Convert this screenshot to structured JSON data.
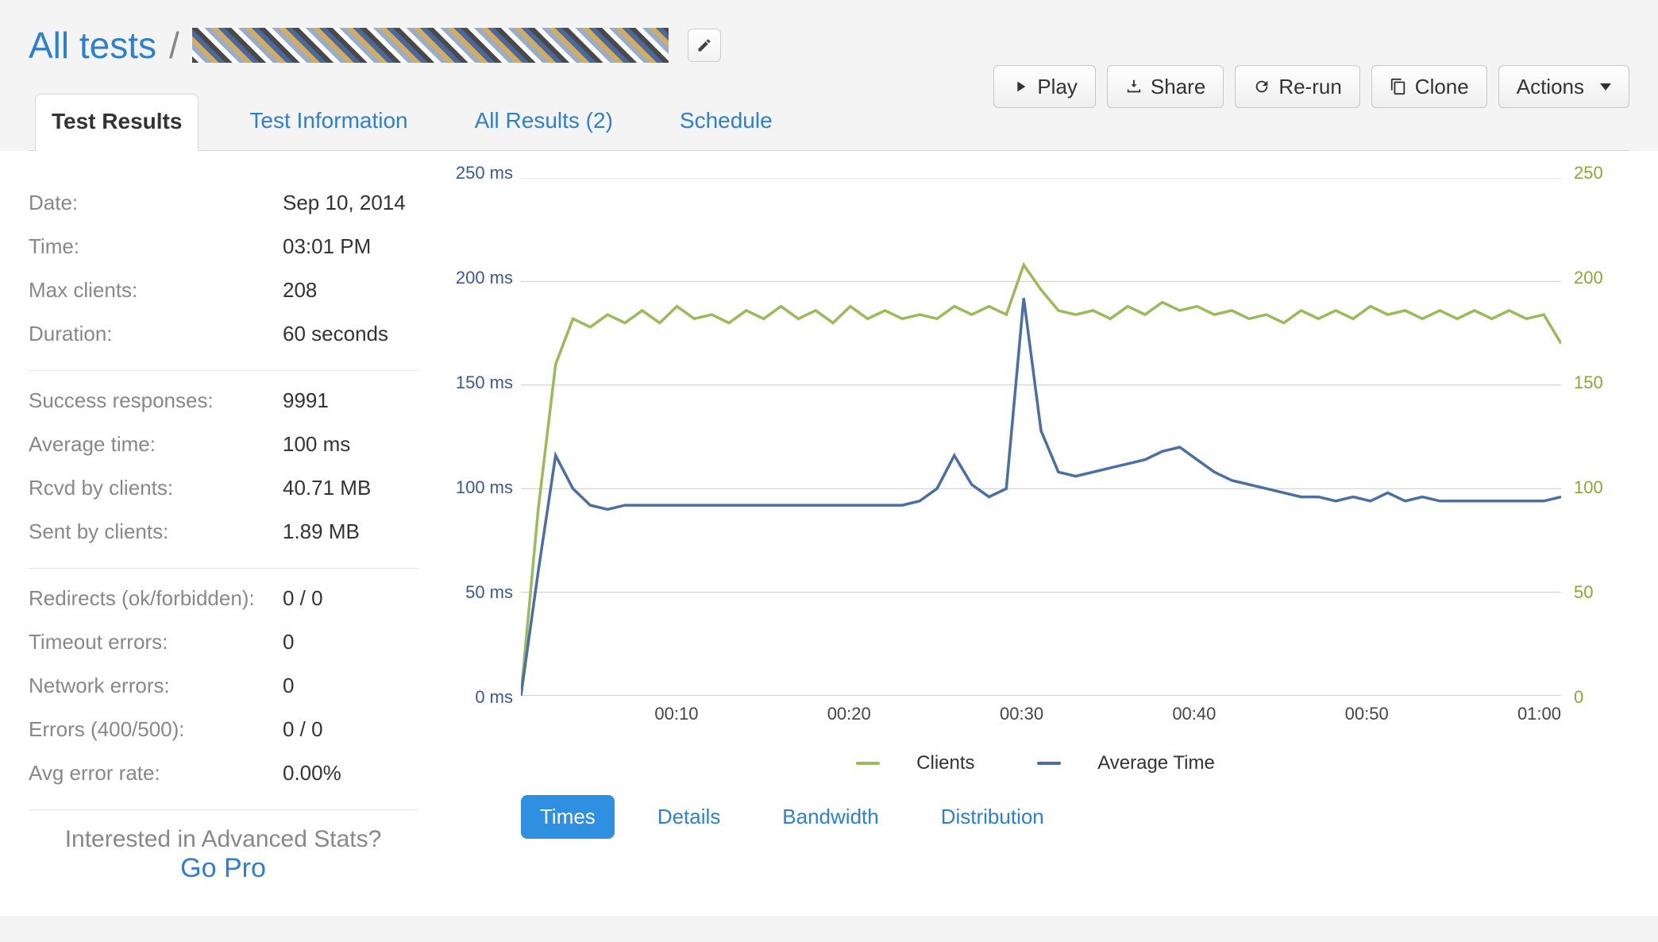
{
  "breadcrumb": {
    "all_tests": "All tests",
    "separator": "/"
  },
  "actions": {
    "play": "Play",
    "share": "Share",
    "rerun": "Re-run",
    "clone": "Clone",
    "actions": "Actions"
  },
  "tabs": {
    "results": "Test Results",
    "info": "Test Information",
    "all_results": "All Results (2)",
    "schedule": "Schedule"
  },
  "stats": {
    "group1": [
      {
        "label": "Date:",
        "value": "Sep 10, 2014"
      },
      {
        "label": "Time:",
        "value": "03:01 PM"
      },
      {
        "label": "Max clients:",
        "value": "208"
      },
      {
        "label": "Duration:",
        "value": "60 seconds"
      }
    ],
    "group2": [
      {
        "label": "Success responses:",
        "value": "9991"
      },
      {
        "label": "Average time:",
        "value": "100 ms"
      },
      {
        "label": "Rcvd by clients:",
        "value": "40.71 MB"
      },
      {
        "label": "Sent by clients:",
        "value": "1.89 MB"
      }
    ],
    "group3": [
      {
        "label": "Redirects (ok/forbidden):",
        "value": "0 / 0"
      },
      {
        "label": "Timeout errors:",
        "value": "0"
      },
      {
        "label": "Network errors:",
        "value": "0"
      },
      {
        "label": "Errors (400/500):",
        "value": "0 / 0"
      },
      {
        "label": "Avg error rate:",
        "value": "0.00%"
      }
    ]
  },
  "promo": {
    "line1": "Interested in Advanced Stats?",
    "line2": "Go Pro"
  },
  "chart_tabs": {
    "times": "Times",
    "details": "Details",
    "bandwidth": "Bandwidth",
    "distribution": "Distribution"
  },
  "legend": {
    "clients": "Clients",
    "avg": "Average Time"
  },
  "chart_data": {
    "type": "line",
    "xlabel": "",
    "x_ticks": [
      "00:10",
      "00:20",
      "00:30",
      "00:40",
      "00:50",
      "01:00"
    ],
    "left_axis": {
      "label_suffix": " ms",
      "ticks": [
        0,
        50,
        100,
        150,
        200,
        250
      ],
      "ylim": [
        0,
        250
      ],
      "color": "#3b5998"
    },
    "right_axis": {
      "label_suffix": "",
      "ticks": [
        0,
        50,
        100,
        150,
        200,
        250
      ],
      "ylim": [
        0,
        250
      ],
      "color": "#8ca63a"
    },
    "series": [
      {
        "name": "Clients",
        "axis": "right",
        "color": "#9bbb59",
        "x": [
          0,
          1,
          2,
          3,
          4,
          5,
          6,
          7,
          8,
          9,
          10,
          11,
          12,
          13,
          14,
          15,
          16,
          17,
          18,
          19,
          20,
          21,
          22,
          23,
          24,
          25,
          26,
          27,
          28,
          29,
          30,
          31,
          32,
          33,
          34,
          35,
          36,
          37,
          38,
          39,
          40,
          41,
          42,
          43,
          44,
          45,
          46,
          47,
          48,
          49,
          50,
          51,
          52,
          53,
          54,
          55,
          56,
          57,
          58,
          59,
          60
        ],
        "values": [
          0,
          90,
          160,
          182,
          178,
          184,
          180,
          186,
          180,
          188,
          182,
          184,
          180,
          186,
          182,
          188,
          182,
          186,
          180,
          188,
          182,
          186,
          182,
          184,
          182,
          188,
          184,
          188,
          184,
          208,
          196,
          186,
          184,
          186,
          182,
          188,
          184,
          190,
          186,
          188,
          184,
          186,
          182,
          184,
          180,
          186,
          182,
          186,
          182,
          188,
          184,
          186,
          182,
          186,
          182,
          186,
          182,
          186,
          182,
          184,
          170
        ]
      },
      {
        "name": "Average Time",
        "axis": "left",
        "color": "#4a6fa5",
        "x": [
          0,
          1,
          2,
          3,
          4,
          5,
          6,
          7,
          8,
          9,
          10,
          11,
          12,
          13,
          14,
          15,
          16,
          17,
          18,
          19,
          20,
          21,
          22,
          23,
          24,
          25,
          26,
          27,
          28,
          29,
          30,
          31,
          32,
          33,
          34,
          35,
          36,
          37,
          38,
          39,
          40,
          41,
          42,
          43,
          44,
          45,
          46,
          47,
          48,
          49,
          50,
          51,
          52,
          53,
          54,
          55,
          56,
          57,
          58,
          59,
          60
        ],
        "values": [
          0,
          60,
          116,
          100,
          92,
          90,
          92,
          92,
          92,
          92,
          92,
          92,
          92,
          92,
          92,
          92,
          92,
          92,
          92,
          92,
          92,
          92,
          92,
          94,
          100,
          116,
          102,
          96,
          100,
          192,
          128,
          108,
          106,
          108,
          110,
          112,
          114,
          118,
          120,
          114,
          108,
          104,
          102,
          100,
          98,
          96,
          96,
          94,
          96,
          94,
          98,
          94,
          96,
          94,
          94,
          94,
          94,
          94,
          94,
          94,
          96
        ]
      }
    ]
  }
}
